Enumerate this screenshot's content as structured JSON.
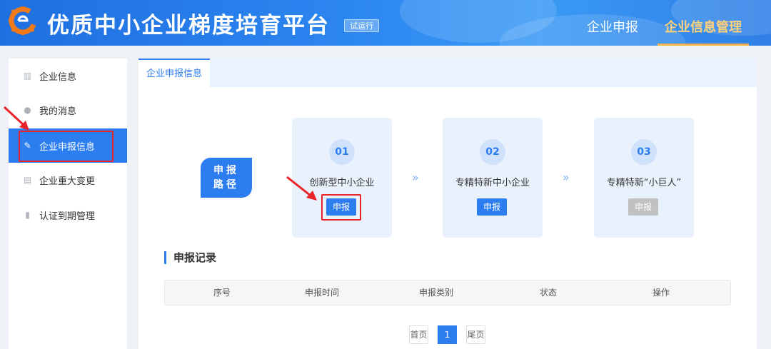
{
  "app": {
    "title": "优质中小企业梯度培育平台",
    "badge": "试运行",
    "brand_color": "#2c7df0"
  },
  "top_nav": [
    {
      "label": "企业申报",
      "active": false
    },
    {
      "label": "企业信息管理",
      "active": true
    }
  ],
  "sidebar": {
    "items": [
      {
        "label": "企业信息",
        "icon": "building-icon",
        "active": false
      },
      {
        "label": "我的消息",
        "icon": "message-icon",
        "active": false
      },
      {
        "label": "企业申报信息",
        "icon": "edit-document-icon",
        "active": true
      },
      {
        "label": "企业重大变更",
        "icon": "document-icon",
        "active": false
      },
      {
        "label": "认证到期管理",
        "icon": "bookmark-icon",
        "active": false
      }
    ]
  },
  "tabs": [
    {
      "label": "企业申报信息",
      "active": true
    }
  ],
  "path_label": {
    "line1": "申报",
    "line2": "路径"
  },
  "steps": [
    {
      "number": "01",
      "name": "创新型中小企业",
      "button": "申报",
      "enabled": true
    },
    {
      "number": "02",
      "name": "专精特新中小企业",
      "button": "申报",
      "enabled": true
    },
    {
      "number": "03",
      "name": "专精特新“小巨人”",
      "button": "申报",
      "enabled": false
    }
  ],
  "records": {
    "title": "申报记录",
    "columns": [
      "序号",
      "申报时间",
      "申报类别",
      "状态",
      "操作"
    ],
    "rows": []
  },
  "pagination": {
    "first": "首页",
    "current": "1",
    "last": "尾页"
  }
}
